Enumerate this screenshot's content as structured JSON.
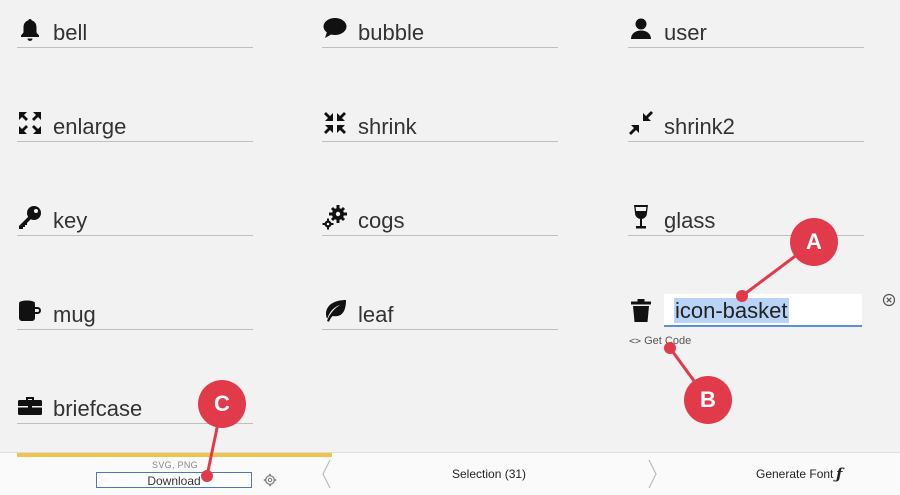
{
  "icons": [
    {
      "name": "bell",
      "icon": "bell-icon"
    },
    {
      "name": "bubble",
      "icon": "bubble-icon"
    },
    {
      "name": "user",
      "icon": "user-icon"
    },
    {
      "name": "enlarge",
      "icon": "enlarge-icon"
    },
    {
      "name": "shrink",
      "icon": "shrink-icon"
    },
    {
      "name": "shrink2",
      "icon": "shrink2-icon"
    },
    {
      "name": "key",
      "icon": "key-icon"
    },
    {
      "name": "cogs",
      "icon": "cogs-icon"
    },
    {
      "name": "glass",
      "icon": "glass-icon"
    },
    {
      "name": "mug",
      "icon": "mug-icon"
    },
    {
      "name": "leaf",
      "icon": "leaf-icon"
    },
    {
      "name": "briefcase",
      "icon": "briefcase-icon"
    }
  ],
  "editing": {
    "icon": "trash-icon",
    "value": "icon-basket",
    "get_code_label": "Get Code"
  },
  "bottombar": {
    "formats": "SVG, PNG",
    "download_label": "Download",
    "selection_label": "Selection (31)",
    "generate_font_label": "Generate Font",
    "download_bar_color": "#f0c34a"
  },
  "markers": [
    "A",
    "B",
    "C"
  ],
  "colors": {
    "marker": "#e03a4b",
    "selection_highlight": "#b8d3f5",
    "input_focus": "#5b8fd6"
  }
}
